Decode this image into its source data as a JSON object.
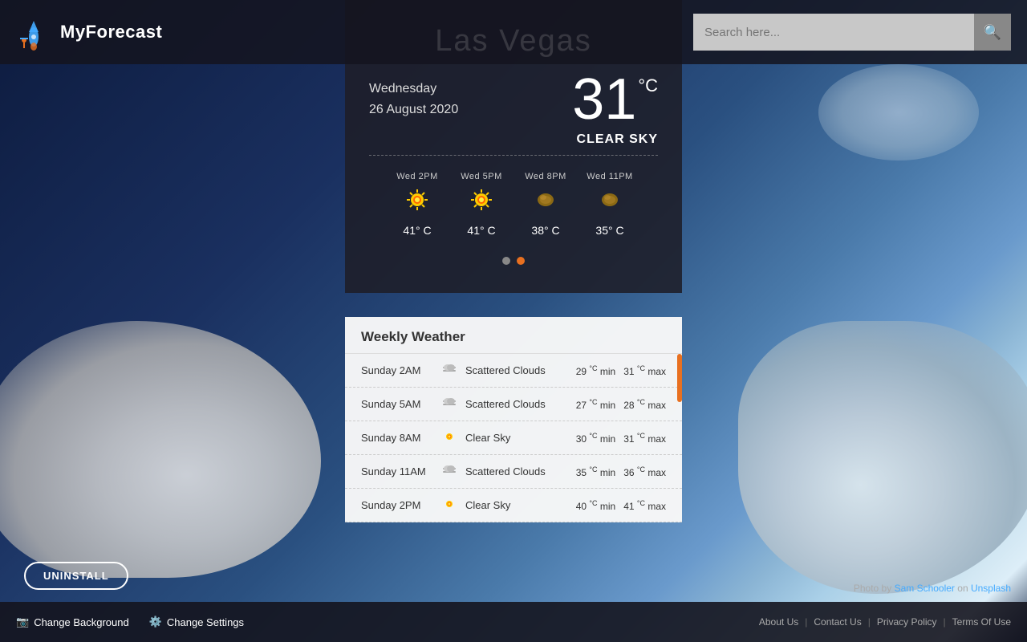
{
  "app": {
    "name": "MyForecast"
  },
  "search": {
    "placeholder": "Search here...",
    "value": ""
  },
  "weather": {
    "city": "Las Vegas",
    "temperature": "31",
    "unit_symbol": "°C",
    "day_full": "Wednesday",
    "date_full": "26 August 2020",
    "condition": "CLEAR SKY",
    "hourly": [
      {
        "label": "Wed 2PM",
        "temp": "41° C",
        "icon": "sun"
      },
      {
        "label": "Wed 5PM",
        "temp": "41° C",
        "icon": "sun"
      },
      {
        "label": "Wed 8PM",
        "temp": "38° C",
        "icon": "moon"
      },
      {
        "label": "Wed 11PM",
        "temp": "35° C",
        "icon": "moon"
      }
    ]
  },
  "weekly": {
    "title": "Weekly Weather",
    "rows": [
      {
        "time": "Sunday 2AM",
        "icon": "cloud",
        "condition": "Scattered Clouds",
        "min": "29",
        "max": "31"
      },
      {
        "time": "Sunday 5AM",
        "icon": "cloud",
        "condition": "Scattered Clouds",
        "min": "27",
        "max": "28"
      },
      {
        "time": "Sunday 8AM",
        "icon": "sun",
        "condition": "Clear Sky",
        "min": "30",
        "max": "31"
      },
      {
        "time": "Sunday 11AM",
        "icon": "cloud",
        "condition": "Scattered Clouds",
        "min": "35",
        "max": "36"
      },
      {
        "time": "Sunday 2PM",
        "icon": "sun",
        "condition": "Clear Sky",
        "min": "40",
        "max": "41"
      }
    ]
  },
  "footer": {
    "change_background": "Change Background",
    "change_settings": "Change Settings",
    "about_us": "About Us",
    "contact_us": "Contact Us",
    "privacy_policy": "Privacy Policy",
    "terms_of_use": "Terms Of Use",
    "photo_credit_prefix": "Photo by ",
    "photo_author": "Sam Schooler",
    "photo_on": " on ",
    "photo_platform": "Unsplash"
  },
  "uninstall": {
    "label": "UNINSTALL"
  }
}
